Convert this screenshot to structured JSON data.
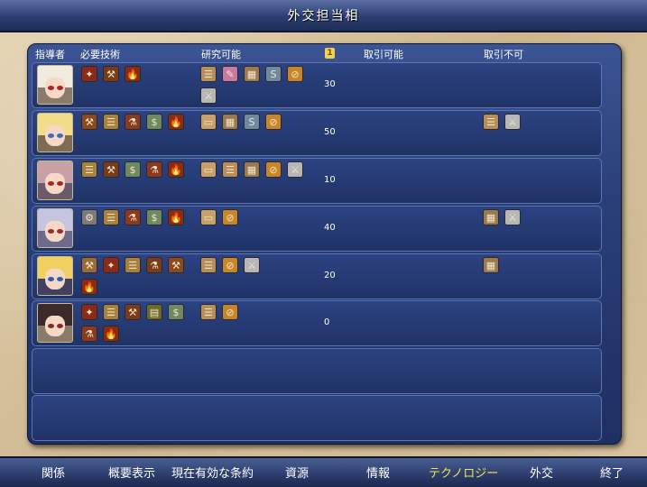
{
  "window": {
    "title": "外交担当相"
  },
  "columns": {
    "leader": "指導者",
    "required_tech": "必要技術",
    "researchable": "研究可能",
    "count_icon": "1",
    "tradable": "取引可能",
    "not_tradable": "取引不可"
  },
  "rows": [
    {
      "count": "30",
      "portrait": {
        "hair": "#f0eadf",
        "eye": "#b22222",
        "bg": "#8a7b6a"
      },
      "required": [
        {
          "glyph": "✦",
          "bg": "#8a2a18"
        },
        {
          "glyph": "⚒",
          "bg": "#7a3b1a"
        },
        {
          "glyph": "🔥",
          "bg": "#8b2c0c"
        }
      ],
      "researchable": [
        {
          "glyph": "☰",
          "bg": "#b98d5a"
        },
        {
          "glyph": "✎",
          "bg": "#c87aa0"
        },
        {
          "glyph": "▦",
          "bg": "#9a7a50"
        },
        {
          "glyph": "S",
          "bg": "#6f8aa0"
        },
        {
          "glyph": "⊘",
          "bg": "#c8862a"
        },
        {
          "glyph": "⚔",
          "bg": "#b7b7b7"
        }
      ],
      "not_tradable": []
    },
    {
      "count": "50",
      "portrait": {
        "hair": "#f1dc8a",
        "eye": "#3e6fb5",
        "bg": "#7e6c52"
      },
      "required": [
        {
          "glyph": "⚒",
          "bg": "#8a4a1e"
        },
        {
          "glyph": "☰",
          "bg": "#a8823c"
        },
        {
          "glyph": "⚗",
          "bg": "#8b3a20"
        },
        {
          "glyph": "$",
          "bg": "#6f8a62"
        },
        {
          "glyph": "🔥",
          "bg": "#8b2c0c"
        }
      ],
      "researchable": [
        {
          "glyph": "▭",
          "bg": "#c9a06a"
        },
        {
          "glyph": "▦",
          "bg": "#9a7a50"
        },
        {
          "glyph": "S",
          "bg": "#6f8aa0"
        },
        {
          "glyph": "⊘",
          "bg": "#c8862a"
        }
      ],
      "not_tradable": [
        {
          "glyph": "☰",
          "bg": "#b98d5a"
        },
        {
          "glyph": "⚔",
          "bg": "#b7b7b7"
        }
      ]
    },
    {
      "count": "10",
      "portrait": {
        "hair": "#c8a0a8",
        "eye": "#b22222",
        "bg": "#6a5a6a"
      },
      "required": [
        {
          "glyph": "☰",
          "bg": "#a8823c"
        },
        {
          "glyph": "⚒",
          "bg": "#7a3b1a"
        },
        {
          "glyph": "$",
          "bg": "#6f8a62"
        },
        {
          "glyph": "⚗",
          "bg": "#8b3a20"
        },
        {
          "glyph": "🔥",
          "bg": "#8b2c0c"
        }
      ],
      "researchable": [
        {
          "glyph": "▭",
          "bg": "#c9a06a"
        },
        {
          "glyph": "☰",
          "bg": "#b98d5a"
        },
        {
          "glyph": "▦",
          "bg": "#9a7a50"
        },
        {
          "glyph": "⊘",
          "bg": "#c8862a"
        },
        {
          "glyph": "⚔",
          "bg": "#b7b7b7"
        }
      ],
      "not_tradable": []
    },
    {
      "count": "40",
      "portrait": {
        "hair": "#c7c4e0",
        "eye": "#a02a2a",
        "bg": "#6d6a8a"
      },
      "required": [
        {
          "glyph": "⚙",
          "bg": "#7b7b7b"
        },
        {
          "glyph": "☰",
          "bg": "#a8823c"
        },
        {
          "glyph": "⚗",
          "bg": "#8b3a20"
        },
        {
          "glyph": "$",
          "bg": "#6f8a62"
        },
        {
          "glyph": "🔥",
          "bg": "#8b2c0c"
        }
      ],
      "researchable": [
        {
          "glyph": "▭",
          "bg": "#c9a06a"
        },
        {
          "glyph": "⊘",
          "bg": "#c8862a"
        }
      ],
      "not_tradable": [
        {
          "glyph": "▦",
          "bg": "#9a7a50"
        },
        {
          "glyph": "⚔",
          "bg": "#b7b7b7"
        }
      ]
    },
    {
      "count": "20",
      "portrait": {
        "hair": "#f0d060",
        "eye": "#2f5fb0",
        "bg": "#404060"
      },
      "required": [
        {
          "glyph": "⚒",
          "bg": "#9a6a3a"
        },
        {
          "glyph": "✦",
          "bg": "#8a2a18"
        },
        {
          "glyph": "☰",
          "bg": "#a8823c"
        },
        {
          "glyph": "⚗",
          "bg": "#7a3b1a"
        },
        {
          "glyph": "⚒",
          "bg": "#8a4a1e"
        },
        {
          "glyph": "🔥",
          "bg": "#8b2c0c"
        }
      ],
      "researchable": [
        {
          "glyph": "☰",
          "bg": "#b98d5a"
        },
        {
          "glyph": "⊘",
          "bg": "#c8862a"
        },
        {
          "glyph": "⚔",
          "bg": "#b7b7b7"
        }
      ],
      "not_tradable": [
        {
          "glyph": "▦",
          "bg": "#9a7a50"
        }
      ]
    },
    {
      "count": "0",
      "portrait": {
        "hair": "#3a2a2a",
        "eye": "#8a2a2a",
        "bg": "#8a7a6a"
      },
      "required": [
        {
          "glyph": "✦",
          "bg": "#8a2a18"
        },
        {
          "glyph": "☰",
          "bg": "#a8823c"
        },
        {
          "glyph": "⚒",
          "bg": "#7a3b1a"
        },
        {
          "glyph": "▤",
          "bg": "#6a6a2a"
        },
        {
          "glyph": "$",
          "bg": "#6f8a62"
        },
        {
          "glyph": "⚗",
          "bg": "#8b3a20"
        },
        {
          "glyph": "🔥",
          "bg": "#8b2c0c"
        }
      ],
      "researchable": [
        {
          "glyph": "☰",
          "bg": "#b98d5a"
        },
        {
          "glyph": "⊘",
          "bg": "#c8862a"
        }
      ],
      "not_tradable": []
    }
  ],
  "bottom_tabs": [
    {
      "label": "関係",
      "active": false
    },
    {
      "label": "概要表示",
      "active": false
    },
    {
      "label": "現在有効な条約",
      "active": false
    },
    {
      "label": "資源",
      "active": false
    },
    {
      "label": "情報",
      "active": false
    },
    {
      "label": "テクノロジー",
      "active": true
    },
    {
      "label": "外交",
      "active": false
    },
    {
      "label": "終了",
      "active": false
    }
  ]
}
